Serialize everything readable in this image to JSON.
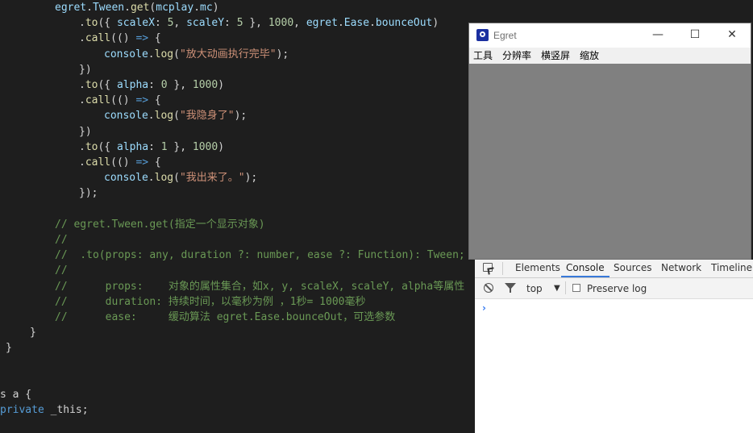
{
  "code_lines": [
    {
      "indent": 68,
      "spans": [
        {
          "t": "egret",
          "c": "var"
        },
        {
          "t": ".",
          "c": "pl"
        },
        {
          "t": "Tween",
          "c": "var"
        },
        {
          "t": ".",
          "c": "pl"
        },
        {
          "t": "get",
          "c": "fn"
        },
        {
          "t": "(",
          "c": "pl"
        },
        {
          "t": "mcplay",
          "c": "var"
        },
        {
          "t": ".",
          "c": "pl"
        },
        {
          "t": "mc",
          "c": "var"
        },
        {
          "t": ")",
          "c": "pl"
        }
      ]
    },
    {
      "indent": 98,
      "spans": [
        {
          "t": ".",
          "c": "pl"
        },
        {
          "t": "to",
          "c": "fn"
        },
        {
          "t": "({ ",
          "c": "pl"
        },
        {
          "t": "scaleX",
          "c": "var"
        },
        {
          "t": ": ",
          "c": "pl"
        },
        {
          "t": "5",
          "c": "num"
        },
        {
          "t": ", ",
          "c": "pl"
        },
        {
          "t": "scaleY",
          "c": "var"
        },
        {
          "t": ": ",
          "c": "pl"
        },
        {
          "t": "5",
          "c": "num"
        },
        {
          "t": " }, ",
          "c": "pl"
        },
        {
          "t": "1000",
          "c": "num"
        },
        {
          "t": ", ",
          "c": "pl"
        },
        {
          "t": "egret",
          "c": "var"
        },
        {
          "t": ".",
          "c": "pl"
        },
        {
          "t": "Ease",
          "c": "var"
        },
        {
          "t": ".",
          "c": "pl"
        },
        {
          "t": "bounceOut",
          "c": "var"
        },
        {
          "t": ")",
          "c": "pl"
        }
      ]
    },
    {
      "indent": 98,
      "spans": [
        {
          "t": ".",
          "c": "pl"
        },
        {
          "t": "call",
          "c": "fn"
        },
        {
          "t": "(() ",
          "c": "pl"
        },
        {
          "t": "=>",
          "c": "kw"
        },
        {
          "t": " {",
          "c": "pl"
        }
      ]
    },
    {
      "indent": 129,
      "spans": [
        {
          "t": "console",
          "c": "var"
        },
        {
          "t": ".",
          "c": "pl"
        },
        {
          "t": "log",
          "c": "fn"
        },
        {
          "t": "(",
          "c": "pl"
        },
        {
          "t": "\"放大动画执行完毕\"",
          "c": "str"
        },
        {
          "t": ");",
          "c": "pl"
        }
      ]
    },
    {
      "indent": 98,
      "spans": [
        {
          "t": "})",
          "c": "pl"
        }
      ]
    },
    {
      "indent": 98,
      "spans": [
        {
          "t": ".",
          "c": "pl"
        },
        {
          "t": "to",
          "c": "fn"
        },
        {
          "t": "({ ",
          "c": "pl"
        },
        {
          "t": "alpha",
          "c": "var"
        },
        {
          "t": ": ",
          "c": "pl"
        },
        {
          "t": "0",
          "c": "num"
        },
        {
          "t": " }, ",
          "c": "pl"
        },
        {
          "t": "1000",
          "c": "num"
        },
        {
          "t": ")",
          "c": "pl"
        }
      ]
    },
    {
      "indent": 98,
      "spans": [
        {
          "t": ".",
          "c": "pl"
        },
        {
          "t": "call",
          "c": "fn"
        },
        {
          "t": "(() ",
          "c": "pl"
        },
        {
          "t": "=>",
          "c": "kw"
        },
        {
          "t": " {",
          "c": "pl"
        }
      ]
    },
    {
      "indent": 129,
      "spans": [
        {
          "t": "console",
          "c": "var"
        },
        {
          "t": ".",
          "c": "pl"
        },
        {
          "t": "log",
          "c": "fn"
        },
        {
          "t": "(",
          "c": "pl"
        },
        {
          "t": "\"我隐身了\"",
          "c": "str"
        },
        {
          "t": ");",
          "c": "pl"
        }
      ]
    },
    {
      "indent": 98,
      "spans": [
        {
          "t": "})",
          "c": "pl"
        }
      ]
    },
    {
      "indent": 98,
      "spans": [
        {
          "t": ".",
          "c": "pl"
        },
        {
          "t": "to",
          "c": "fn"
        },
        {
          "t": "({ ",
          "c": "pl"
        },
        {
          "t": "alpha",
          "c": "var"
        },
        {
          "t": ": ",
          "c": "pl"
        },
        {
          "t": "1",
          "c": "num"
        },
        {
          "t": " }, ",
          "c": "pl"
        },
        {
          "t": "1000",
          "c": "num"
        },
        {
          "t": ")",
          "c": "pl"
        }
      ]
    },
    {
      "indent": 98,
      "spans": [
        {
          "t": ".",
          "c": "pl"
        },
        {
          "t": "call",
          "c": "fn"
        },
        {
          "t": "(() ",
          "c": "pl"
        },
        {
          "t": "=>",
          "c": "kw"
        },
        {
          "t": " {",
          "c": "pl"
        }
      ]
    },
    {
      "indent": 129,
      "spans": [
        {
          "t": "console",
          "c": "var"
        },
        {
          "t": ".",
          "c": "pl"
        },
        {
          "t": "log",
          "c": "fn"
        },
        {
          "t": "(",
          "c": "pl"
        },
        {
          "t": "\"我出来了。\"",
          "c": "str"
        },
        {
          "t": ");",
          "c": "pl"
        }
      ]
    },
    {
      "indent": 98,
      "spans": [
        {
          "t": "});",
          "c": "pl"
        }
      ]
    },
    {
      "indent": 0,
      "spans": []
    },
    {
      "indent": 68,
      "spans": [
        {
          "t": "// egret.Tween.get(指定一个显示对象)",
          "c": "cm"
        }
      ]
    },
    {
      "indent": 68,
      "spans": [
        {
          "t": "//",
          "c": "cm"
        }
      ]
    },
    {
      "indent": 68,
      "spans": [
        {
          "t": "//  .to(props: any, duration ?: number, ease ?: Function): Tween;",
          "c": "cm"
        }
      ]
    },
    {
      "indent": 68,
      "spans": [
        {
          "t": "//",
          "c": "cm"
        }
      ]
    },
    {
      "indent": 68,
      "spans": [
        {
          "t": "//      props:    对象的属性集合，如x, y, scaleX, scaleY, alpha等属性",
          "c": "cm"
        }
      ]
    },
    {
      "indent": 68,
      "spans": [
        {
          "t": "//      duration: 持续时间，以毫秒为例 ，1秒= 1000毫秒",
          "c": "cm"
        }
      ]
    },
    {
      "indent": 68,
      "spans": [
        {
          "t": "//      ease:     缓动算法 egret.Ease.bounceOut，可选参数",
          "c": "cm"
        }
      ]
    },
    {
      "indent": 37,
      "spans": [
        {
          "t": "}",
          "c": "pl"
        }
      ]
    },
    {
      "indent": 7,
      "spans": [
        {
          "t": "}",
          "c": "pl"
        }
      ]
    },
    {
      "indent": 0,
      "spans": []
    },
    {
      "indent": 0,
      "spans": []
    },
    {
      "indent": 0,
      "spans": [
        {
          "t": "s a {",
          "c": "pl"
        }
      ]
    },
    {
      "indent": 0,
      "spans": [
        {
          "t": "private",
          "c": "kw"
        },
        {
          "t": " _this;",
          "c": "pl"
        }
      ]
    }
  ],
  "egret_window": {
    "title": "Egret",
    "controls": {
      "minimize": "—",
      "maximize": "☐",
      "close": "✕"
    },
    "menu": {
      "tools": "工具",
      "resolution": "分辨率",
      "orientation": "横竖屏",
      "zoom": "缩放"
    }
  },
  "devtools": {
    "tabs": {
      "elements": "Elements",
      "console": "Console",
      "sources": "Sources",
      "network": "Network",
      "timeline": "Timeline"
    },
    "context": "top",
    "context_arrow": "▼",
    "preserve_log": "Preserve log",
    "prompt": "›"
  }
}
